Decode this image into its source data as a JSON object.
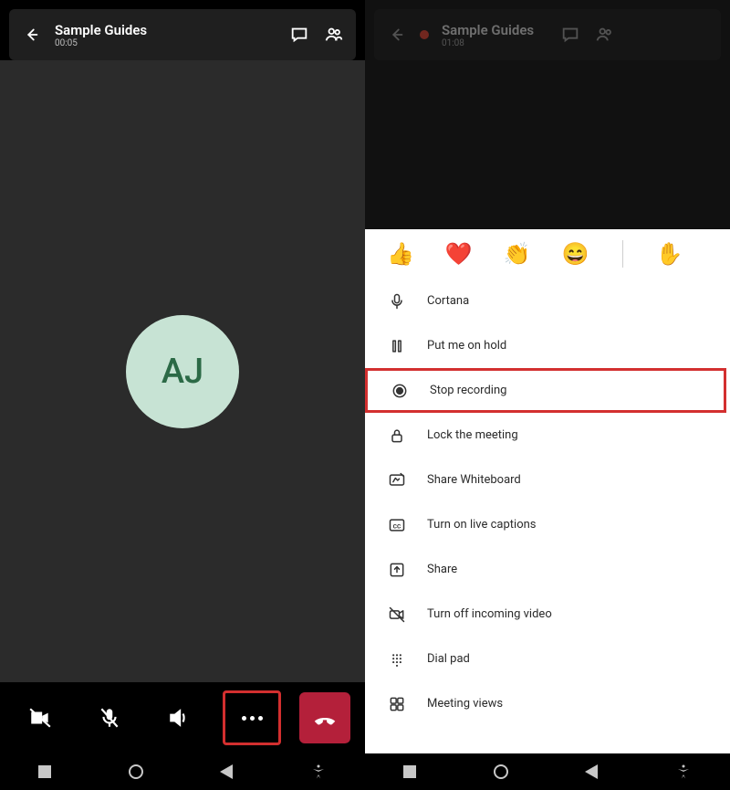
{
  "left": {
    "title": "Sample Guides",
    "time": "00:05",
    "avatar_initials": "AJ"
  },
  "right": {
    "title": "Sample Guides",
    "time": "01:08",
    "reactions": [
      "👍",
      "❤️",
      "👏",
      "😄",
      "✋"
    ],
    "menu": [
      {
        "label": "Cortana",
        "icon": "mic"
      },
      {
        "label": "Put me on hold",
        "icon": "pause"
      },
      {
        "label": "Stop recording",
        "icon": "record",
        "highlighted": true
      },
      {
        "label": "Lock the meeting",
        "icon": "lock"
      },
      {
        "label": "Share Whiteboard",
        "icon": "whiteboard"
      },
      {
        "label": "Turn on live captions",
        "icon": "cc"
      },
      {
        "label": "Share",
        "icon": "share"
      },
      {
        "label": "Turn off incoming video",
        "icon": "video-off"
      },
      {
        "label": "Dial pad",
        "icon": "dialpad"
      },
      {
        "label": "Meeting views",
        "icon": "grid"
      }
    ]
  }
}
